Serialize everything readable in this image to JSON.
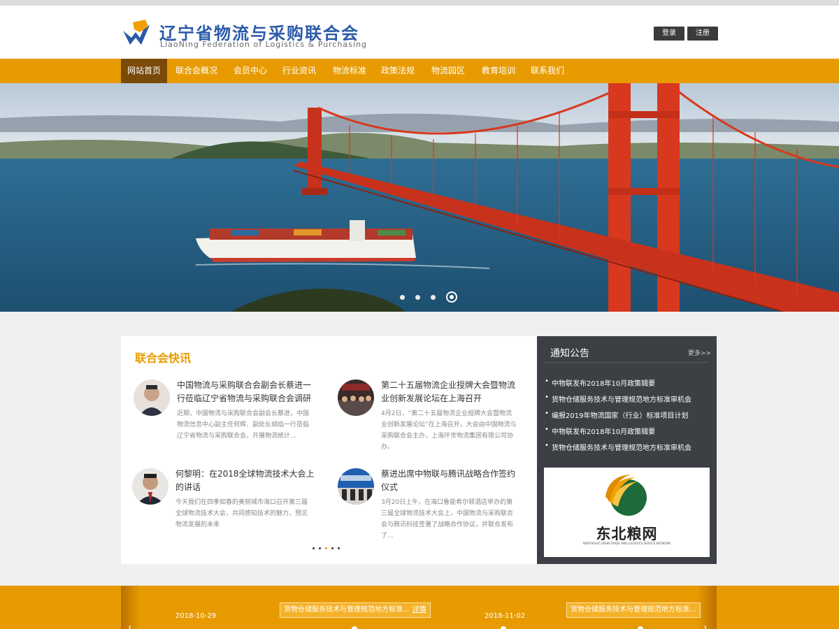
{
  "header": {
    "brand_cn": "辽宁省物流与采购联合会",
    "brand_en": "LiaoNing Federation of Logistics & Purchasing",
    "login_label": "登录",
    "register_label": "注册"
  },
  "nav": {
    "items": [
      {
        "label": "网站首页",
        "active": true
      },
      {
        "label": "联合会概况"
      },
      {
        "label": "会员中心"
      },
      {
        "label": "行业资讯"
      },
      {
        "label": "物流标准"
      },
      {
        "label": "政策法规"
      },
      {
        "label": "物流园区"
      },
      {
        "label": "教育培训"
      },
      {
        "label": "联系我们"
      }
    ]
  },
  "banner": {
    "slide_count": 4,
    "active_slide": 4
  },
  "news": {
    "title": "联合会快讯",
    "items": [
      {
        "headline": "中国物流与采购联合会副会长蔡进一行莅临辽宁省物流与采购联合会调研",
        "desc": "近期，中国物流与采购联合会副会长蔡进，中国物流信息中心副主任何辉、副处长胡焰一行莅临辽宁省物流与采购联合会，开展物流统计..."
      },
      {
        "headline": "第二十五届物流企业授牌大会暨物流业创新发展论坛在上海召开",
        "desc": "4月2日，“第二十五届物流企业授牌大会暨物流业创新发展论坛”在上海召开，大会由中国物流与采购联合会主办，上海环世物流集团有限公司协办。"
      },
      {
        "headline": "何黎明：在2018全球物流技术大会上的讲话",
        "desc": "今天我们在四季如春的美丽城市海口召开第三届全球物流技术大会，共同感知技术的魅力，预见物流发展的未来"
      },
      {
        "headline": "蔡进出席中物联与腾讯战略合作签约仪式",
        "desc": "3月20日上午，在海口鲁能希尔顿酒店举办的第三届全球物流技术大会上，中国物流与采购联合会与腾讯科技签署了战略合作协议，并联合发布了..."
      }
    ],
    "page_count": 5,
    "active_page": 3
  },
  "notice": {
    "title": "通知公告",
    "more_label": "更多>>",
    "items": [
      "中物联发布2018年10月政策辑要",
      "货物仓储服务技术与管理规范地方标准审机会",
      "编报2019年物流国家（行业）标准项目计划",
      "中物联发布2018年10月政策辑要",
      "货物仓储服务技术与管理规范地方标准审机会"
    ],
    "ad": {
      "name": "东北粮网",
      "sub": "NORTHEAST GRAIN TRADE AND LOGISTICS SERVICE NETWORK"
    }
  },
  "timeline": {
    "entries": [
      {
        "date": "2018-10-29",
        "tip": "货物仓储服务技术与管理规范地方标准...",
        "detail": "详情"
      },
      {
        "date": "2018-11-02",
        "tip": "货物仓储服务技术与管理规范地方标准...",
        "detail": ""
      }
    ],
    "prev_arrow": "‹",
    "next_arrow": "›"
  },
  "colors": {
    "accent": "#e89b00",
    "nav_active": "#7a4a08",
    "brand_blue": "#2a5aa8",
    "notice_bg": "#3c3f43"
  }
}
